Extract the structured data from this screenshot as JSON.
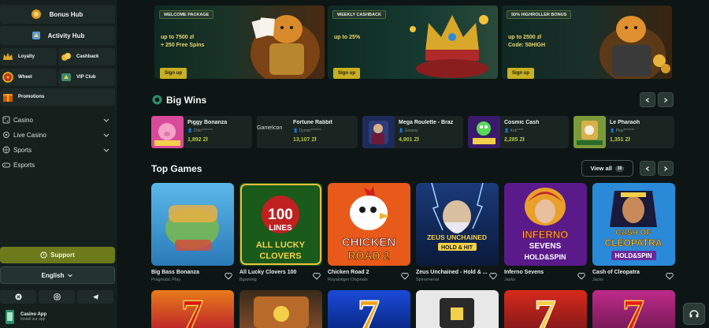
{
  "sidebar": {
    "bonus_hub": "Bonus Hub",
    "activity_hub": "Activity Hub",
    "tiles": [
      {
        "label": "Loyalty",
        "icon": "crown-icon"
      },
      {
        "label": "Cashback",
        "icon": "coins-icon"
      },
      {
        "label": "Wheel",
        "icon": "wheel-icon"
      },
      {
        "label": "VIP Club",
        "icon": "vip-icon"
      },
      {
        "label": "Promotions",
        "icon": "gift-icon"
      }
    ],
    "nav": [
      {
        "label": "Casino",
        "icon": "casino-icon",
        "expandable": true
      },
      {
        "label": "Live Casino",
        "icon": "live-icon",
        "expandable": true
      },
      {
        "label": "Sports",
        "icon": "ball-icon",
        "expandable": true
      },
      {
        "label": "Esports",
        "icon": "gamepad-icon",
        "expandable": false
      }
    ],
    "support": "Support",
    "language": "English",
    "social": [
      "x-icon",
      "instagram-icon",
      "telegram-icon"
    ],
    "app_title": "Casino App",
    "app_sub": "Install our app"
  },
  "promos": [
    {
      "tag": "WELCOME PACKAGE",
      "line1": "up to 7500 zł",
      "line2": "+ 250 Free Spins",
      "button": "Sign up"
    },
    {
      "tag": "WEEKLY CASHBACK",
      "line1": "up to 25%",
      "line2": "",
      "button": "Sign up"
    },
    {
      "tag": "50% HIGHROLLER BONUS",
      "line1": "up to 2500 zł",
      "line2": "Code: 50HIGH",
      "button": "Sign up"
    }
  ],
  "big_wins": {
    "title": "Big Wins",
    "items": [
      {
        "name": "Piggy Bonanza",
        "user": "Chlo*******",
        "amount": "1,892 Zł"
      },
      {
        "name": "Fortune Rabbit",
        "user": "Dymm*******",
        "amount": "13,107 Zł",
        "alt": "GameIcon"
      },
      {
        "name": "Mega Roulette - Braz",
        "user": "Gnsexy",
        "amount": "4,901 Zł"
      },
      {
        "name": "Cosmic Cash",
        "user": "Kok****",
        "amount": "2,285 Zł"
      },
      {
        "name": "Le Pharaoh",
        "user": "Play*******",
        "amount": "1,351 Zł"
      }
    ]
  },
  "top_games": {
    "title": "Top Games",
    "view_all": "View all",
    "count": "30",
    "items": [
      {
        "name": "Big Bass Bonanza",
        "provider": "Pragmatic Play"
      },
      {
        "name": "All Lucky Clovers 100",
        "provider": "Bgaming",
        "art": [
          "100",
          "LINES",
          "ALL LUCKY",
          "CLOVERS"
        ]
      },
      {
        "name": "Chicken Road 2",
        "provider": "Royalstiger Originals",
        "art": [
          "CHICKEN",
          "ROAD 2"
        ]
      },
      {
        "name": "Zeus Unchained - Hold & ...",
        "provider": "Spinomenal",
        "art": [
          "ZEUS UNCHAINED",
          "HOLD & HIT"
        ]
      },
      {
        "name": "Inferno Sevens",
        "provider": "Jacks",
        "art": [
          "INFERNO",
          "SEVENS",
          "HOLD&SPIN"
        ]
      },
      {
        "name": "Cash of Cleopatra",
        "provider": "Jacks",
        "art": [
          "CASH OF",
          "CLEOPATRA",
          "HOLD&SPIN"
        ]
      }
    ]
  },
  "colors": {
    "accent": "#c8b022",
    "support": "#6c7a1b",
    "amount": "#b8c84a"
  }
}
